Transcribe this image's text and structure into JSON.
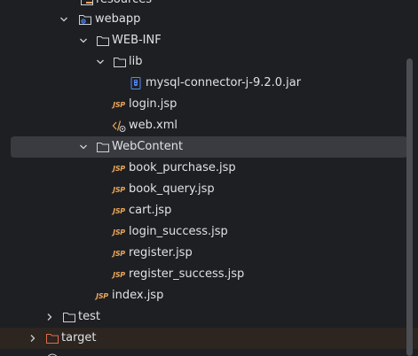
{
  "tree": {
    "items": [
      {
        "label": "resources",
        "icon": "folder-icon"
      },
      {
        "label": "webapp",
        "icon": "web-folder-icon"
      },
      {
        "label": "WEB-INF",
        "icon": "folder-icon"
      },
      {
        "label": "lib",
        "icon": "folder-icon"
      },
      {
        "label": "mysql-connector-j-9.2.0.jar",
        "icon": "jar-icon"
      },
      {
        "label": "login.jsp",
        "icon": "jsp-icon"
      },
      {
        "label": "web.xml",
        "icon": "xml-icon"
      },
      {
        "label": "WebContent",
        "icon": "folder-icon"
      },
      {
        "label": "book_purchase.jsp",
        "icon": "jsp-icon"
      },
      {
        "label": "book_query.jsp",
        "icon": "jsp-icon"
      },
      {
        "label": "cart.jsp",
        "icon": "jsp-icon"
      },
      {
        "label": "login_success.jsp",
        "icon": "jsp-icon"
      },
      {
        "label": "register.jsp",
        "icon": "jsp-icon"
      },
      {
        "label": "register_success.jsp",
        "icon": "jsp-icon"
      },
      {
        "label": "index.jsp",
        "icon": "jsp-icon"
      },
      {
        "label": "test",
        "icon": "folder-icon"
      },
      {
        "label": "target",
        "icon": "excluded-folder-icon"
      }
    ]
  },
  "icons": {
    "jsp_text": "JSP"
  },
  "colors": {
    "background": "#1e1f22",
    "text": "#dfe1e5",
    "selection": "#393b40",
    "excluded_row": "#2c2520",
    "jsp_icon": "#e9a65a",
    "jar_icon": "#548af7",
    "excluded_folder": "#e06c4c"
  }
}
